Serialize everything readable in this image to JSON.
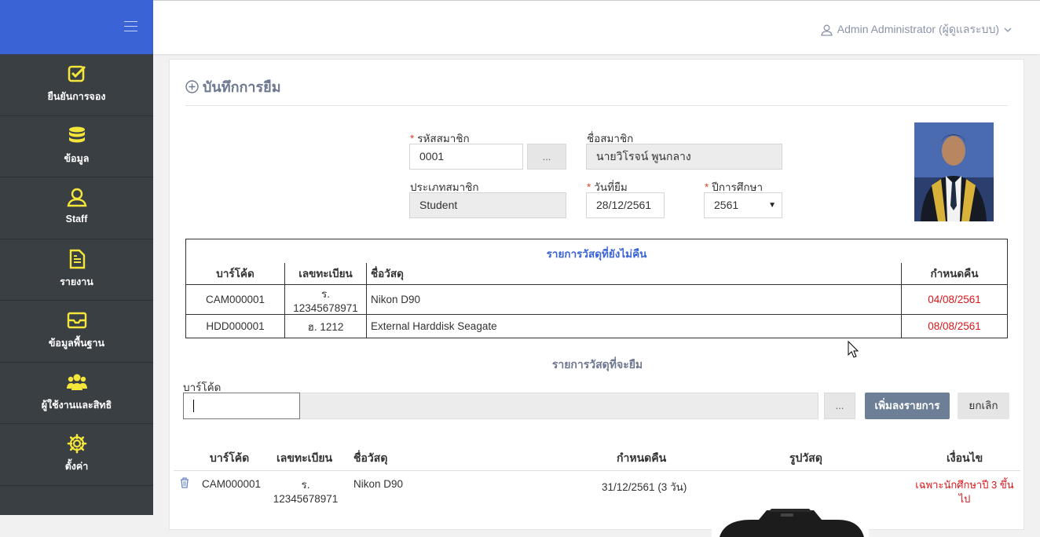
{
  "sidebar": {
    "items": [
      {
        "label": "ยืนยันการจอง",
        "icon": "check-square-icon"
      },
      {
        "label": "ข้อมูล",
        "icon": "database-icon"
      },
      {
        "label": "Staff",
        "icon": "user-icon"
      },
      {
        "label": "รายงาน",
        "icon": "file-text-icon"
      },
      {
        "label": "ข้อมูลพื้นฐาน",
        "icon": "inbox-icon"
      },
      {
        "label": "ผู้ใช้งานและสิทธิ",
        "icon": "users-icon"
      },
      {
        "label": "ตั้งค่า",
        "icon": "gear-icon"
      }
    ],
    "accent": "#f5e63a"
  },
  "topbar": {
    "user": "Admin Administrator (ผู้ดูแลระบบ)"
  },
  "page": {
    "title": "บันทึกการยืม"
  },
  "form": {
    "member_code_label": "รหัสสมาชิก",
    "member_code_value": "0001",
    "browse_label": "...",
    "member_name_label": "ชื่อสมาชิก",
    "member_name_value": "นายวิโรจน์ พูนกลาง",
    "member_type_label": "ประเภทสมาชิก",
    "member_type_value": "Student",
    "borrow_date_label": "วันที่ยืม",
    "borrow_date_value": "28/12/2561",
    "academic_year_label": "ปีการศึกษา",
    "academic_year_value": "2561"
  },
  "unreturned": {
    "caption": "รายการวัสดุที่ยังไม่คืน",
    "headers": [
      "บาร์โค้ด",
      "เลขทะเบียน",
      "ชื่อวัสดุ",
      "กำหนดคืน"
    ],
    "rows": [
      [
        "CAM000001",
        "ร. 12345678971",
        "Nikon D90",
        "04/08/2561"
      ],
      [
        "HDD000001",
        "ฮ. 1212",
        "External Harddisk Seagate",
        "08/08/2561"
      ]
    ]
  },
  "borrow": {
    "caption": "รายการวัสดุที่จะยืม",
    "barcode_label": "บาร์โค้ด",
    "barcode_value": "",
    "browse_label": "...",
    "add_label": "เพิ่มลงรายการ",
    "cancel_label": "ยกเลิก",
    "headers": [
      "บาร์โค้ด",
      "เลขทะเบียน",
      "ชื่อวัสดุ",
      "กำหนดคืน",
      "รูปวัสดุ",
      "เงื่อนไข"
    ],
    "rows": [
      {
        "barcode": "CAM000001",
        "reg_no": "ร. 12345678971",
        "name": "Nikon D90",
        "due": "31/12/2561 (3 วัน)",
        "condition": "เฉพาะนักศึกษาปี 3 ขึ้นไป"
      }
    ]
  }
}
